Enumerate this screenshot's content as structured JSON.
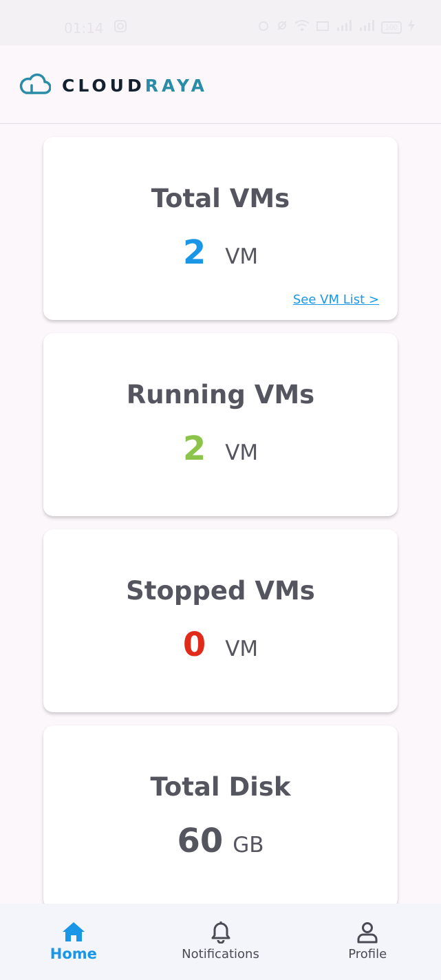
{
  "status_bar": {
    "time": "01:14",
    "battery": "100"
  },
  "header": {
    "logo_part1": "CLOUD",
    "logo_part2": "RAYA"
  },
  "cards": [
    {
      "title": "Total VMs",
      "value": "2",
      "unit": "VM",
      "link": "See VM List >",
      "value_color": "#1a96e6"
    },
    {
      "title": "Running VMs",
      "value": "2",
      "unit": "VM",
      "value_color": "#8cc34a"
    },
    {
      "title": "Stopped VMs",
      "value": "0",
      "unit": "VM",
      "value_color": "#e02a1a"
    },
    {
      "title": "Total Disk",
      "value": "60",
      "unit": "GB",
      "value_color": "#555560"
    }
  ],
  "nav": {
    "home": "Home",
    "notifications": "Notifications",
    "profile": "Profile"
  },
  "colors": {
    "accent": "#1a96e6",
    "brand_teal": "#2a8ca6",
    "brand_dark": "#13202e"
  }
}
